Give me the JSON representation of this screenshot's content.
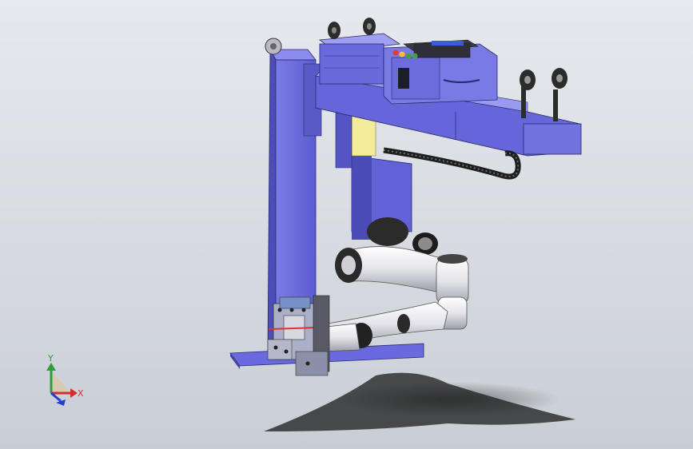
{
  "viewport": {
    "background_top": "#e6e9ee",
    "background_bottom": "#c9ced5"
  },
  "model": {
    "body_color": "#6f6fe0",
    "body_dark": "#4b4bb8",
    "body_light": "#9a9af0",
    "arm_color": "#e8e8ee",
    "joint_color": "#2a2a2a",
    "accent_yellow": "#f2ec9a",
    "status_lights": [
      "#e53935",
      "#fbc02d",
      "#43a047",
      "#43a047"
    ]
  },
  "triad": {
    "y_label": "Y",
    "x_label": "X",
    "y_color": "#2e9e3a",
    "x_color": "#d32f2f",
    "z_color": "#1e3fd0"
  }
}
